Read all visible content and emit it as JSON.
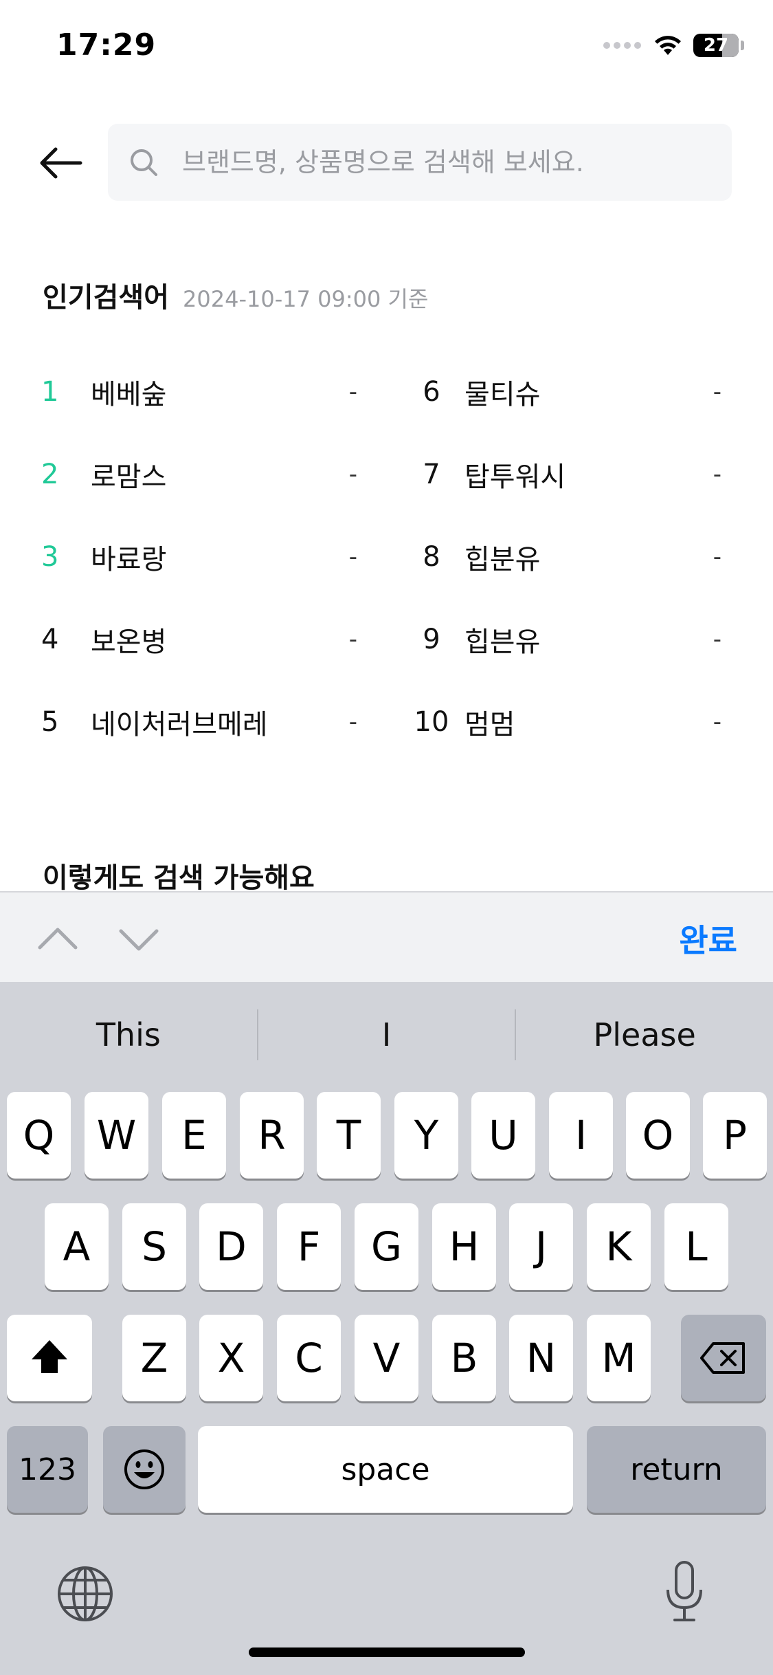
{
  "status_bar": {
    "time": "17:29",
    "battery": "27"
  },
  "search": {
    "placeholder": "브랜드명, 상품명으로 검색해 보세요.",
    "value": ""
  },
  "popular": {
    "title": "인기검색어",
    "updated": "2024-10-17 09:00 기준",
    "left": [
      {
        "rank": "1",
        "keyword": "베베숲",
        "change": "-"
      },
      {
        "rank": "2",
        "keyword": "로맘스",
        "change": "-"
      },
      {
        "rank": "3",
        "keyword": "바료랑",
        "change": "-"
      },
      {
        "rank": "4",
        "keyword": "보온병",
        "change": "-"
      },
      {
        "rank": "5",
        "keyword": "네이처러브메레",
        "change": "-"
      }
    ],
    "right": [
      {
        "rank": "6",
        "keyword": "물티슈",
        "change": "-"
      },
      {
        "rank": "7",
        "keyword": "탑투워시",
        "change": "-"
      },
      {
        "rank": "8",
        "keyword": "힙분유",
        "change": "-"
      },
      {
        "rank": "9",
        "keyword": "힙븐유",
        "change": "-"
      },
      {
        "rank": "10",
        "keyword": "멈멈",
        "change": "-"
      }
    ]
  },
  "suggest_title": "이렇게도 검색 가능해요",
  "accessory": {
    "done_label": "완료"
  },
  "keyboard": {
    "suggestions": [
      "This",
      "I",
      "Please"
    ],
    "row1": [
      "Q",
      "W",
      "E",
      "R",
      "T",
      "Y",
      "U",
      "I",
      "O",
      "P"
    ],
    "row2": [
      "A",
      "S",
      "D",
      "F",
      "G",
      "H",
      "J",
      "K",
      "L"
    ],
    "row3": [
      "Z",
      "X",
      "C",
      "V",
      "B",
      "N",
      "M"
    ],
    "numbers_label": "123",
    "space_label": "space",
    "return_label": "return"
  },
  "colors": {
    "top_rank": "#20c997",
    "accent": "#0a7aff",
    "keyboard_bg": "#d1d3d9"
  },
  "icons": [
    "back-arrow-icon",
    "search-icon",
    "wifi-icon",
    "chevron-up-icon",
    "chevron-down-icon",
    "shift-icon",
    "backspace-icon",
    "emoji-icon",
    "globe-icon",
    "microphone-icon"
  ]
}
